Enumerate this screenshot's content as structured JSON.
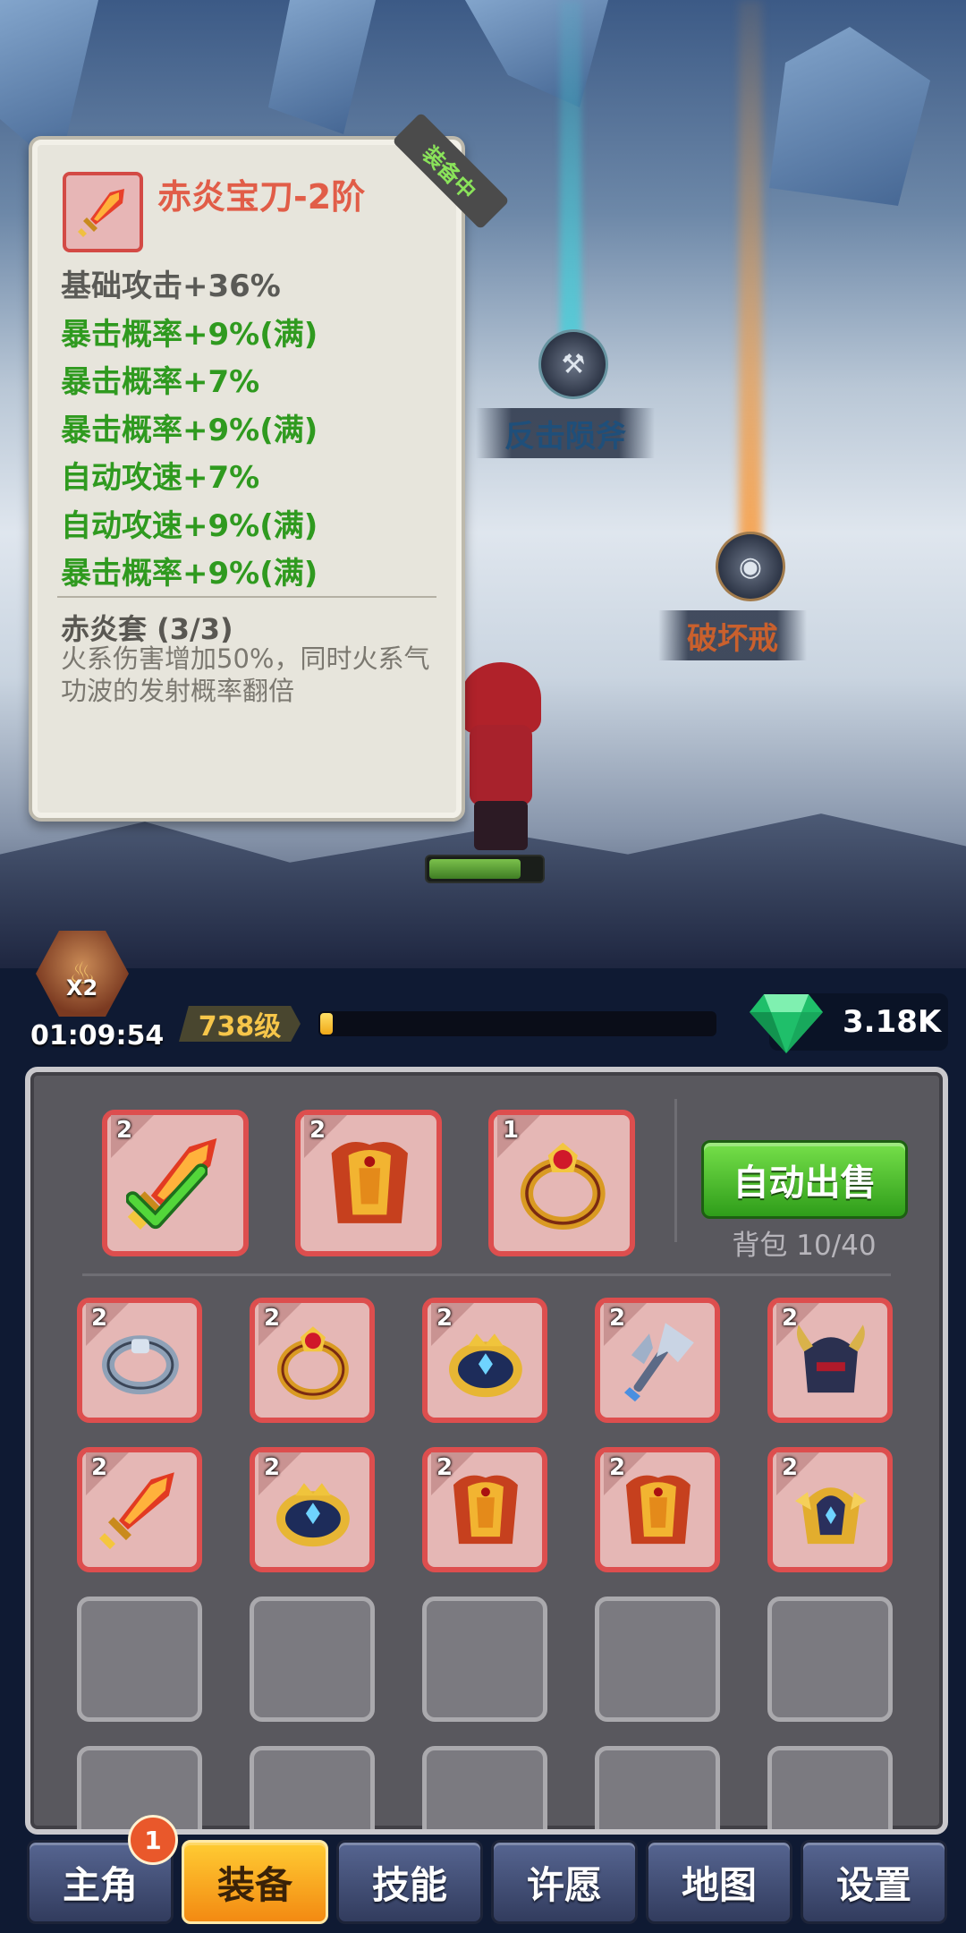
{
  "scene": {
    "skills": [
      {
        "name": "反击陨斧",
        "color": "#1f4f7a"
      },
      {
        "name": "破坏戒",
        "color": "#c9602d"
      }
    ],
    "hero_hp_fraction": 0.82
  },
  "tooltip": {
    "item_name": "赤炎宝刀-2阶",
    "equipped_tag": "装备中",
    "stats": [
      {
        "text": "基础攻击+36%",
        "color": "#5a5a56"
      },
      {
        "text": "暴击概率+9%(满)",
        "color": "#2f9a1f"
      },
      {
        "text": "暴击概率+7%",
        "color": "#2f9a1f"
      },
      {
        "text": "暴击概率+9%(满)",
        "color": "#2f9a1f"
      },
      {
        "text": "自动攻速+7%",
        "color": "#2f9a1f"
      },
      {
        "text": "自动攻速+9%(满)",
        "color": "#2f9a1f"
      },
      {
        "text": "暴击概率+9%(满)",
        "color": "#2f9a1f"
      }
    ],
    "set_title": "赤炎套 (3/3)",
    "set_desc": "火系伤害增加50%，同时火系气功波的发射概率翻倍"
  },
  "hud": {
    "boost_multiplier": "X2",
    "timer": "01:09:54",
    "level": "738级",
    "exp_fraction": 0.02,
    "gems": "3.18K"
  },
  "inventory": {
    "equipped": [
      {
        "tier": "2",
        "item": "flame-sword",
        "checked": true
      },
      {
        "tier": "2",
        "item": "flame-armor",
        "checked": false
      },
      {
        "tier": "1",
        "item": "ruby-ring",
        "checked": false
      }
    ],
    "auto_sell_label": "自动出售",
    "bag_label": "背包 10/40",
    "bag_rows": [
      [
        {
          "tier": "2",
          "item": "silver-ring"
        },
        {
          "tier": "2",
          "item": "ruby-ring"
        },
        {
          "tier": "2",
          "item": "sapphire-crown-ring"
        },
        {
          "tier": "2",
          "item": "frost-axe"
        },
        {
          "tier": "2",
          "item": "horned-helmet"
        }
      ],
      [
        {
          "tier": "2",
          "item": "flame-sword"
        },
        {
          "tier": "2",
          "item": "sapphire-crown-ring"
        },
        {
          "tier": "2",
          "item": "flame-armor"
        },
        {
          "tier": "2",
          "item": "flame-armor"
        },
        {
          "tier": "2",
          "item": "gold-helmet"
        }
      ]
    ],
    "empty_rows": 2
  },
  "nav": {
    "tabs": [
      "主角",
      "装备",
      "技能",
      "许愿",
      "地图",
      "设置"
    ],
    "active_index": 1,
    "badge_count": "1"
  },
  "colors": {
    "accent_green": "#2f9a1f",
    "item_name_red": "#e15d48",
    "slot_border": "#dd4e4e"
  }
}
